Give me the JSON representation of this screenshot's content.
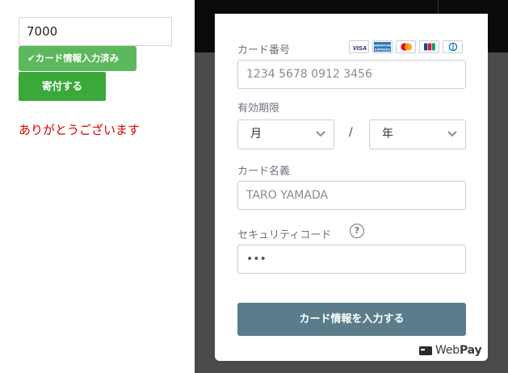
{
  "donation": {
    "amount_value": "7000",
    "card_entered_badge": "✔カード情報入力済み",
    "donate_button_label": "寄付する",
    "thanks_message": "ありがとうございます"
  },
  "payment_modal": {
    "card_number": {
      "label": "カード番号",
      "placeholder": "1234 5678 0912 3456"
    },
    "card_brands": [
      "VISA",
      "American Express",
      "Mastercard",
      "JCB",
      "Diners Club"
    ],
    "expiry": {
      "label": "有効期限",
      "month_placeholder": "月",
      "separator": "/",
      "year_placeholder": "年"
    },
    "cardholder": {
      "label": "カード名義",
      "placeholder": "TARO YAMADA"
    },
    "security_code": {
      "label": "セキュリティコード",
      "help_icon_text": "?",
      "placeholder": "•••"
    },
    "submit_label": "カード情報を入力する",
    "brand_logo": {
      "text_web": "Web",
      "text_pay": "Pay"
    }
  },
  "colors": {
    "badge_green": "#5cb85c",
    "button_green": "#3aa93a",
    "thanks_red": "#d60000",
    "submit_slate": "#5b7c8a",
    "overlay": "#4a4a4a"
  }
}
